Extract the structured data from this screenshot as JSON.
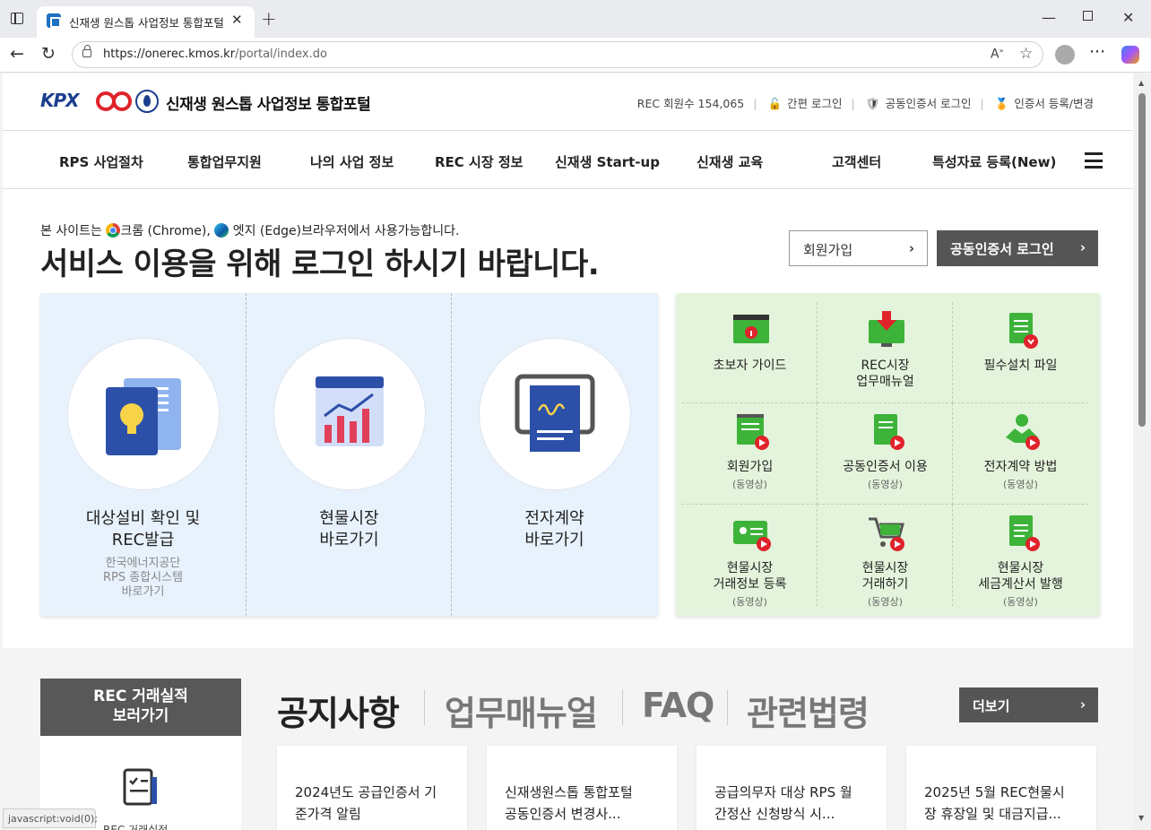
{
  "browser": {
    "tab_title": "신재생 원스톱 사업정보 통합포털",
    "url_host": "https://onerec.kmos.kr",
    "url_path": "/portal/index.do",
    "status_text": "javascript:void(0);"
  },
  "header": {
    "logo_kpx": "KPX",
    "site_title": "신재생 원스톱 사업정보 통합포털",
    "rec_members": "REC 회원수 154,065",
    "simple_login": "간편 로그인",
    "cert_login": "공동인증서 로그인",
    "cert_register": "인증서 등록/변경"
  },
  "gnb": [
    "RPS 사업절차",
    "통합업무지원",
    "나의 사업 정보",
    "REC 시장 정보",
    "신재생 Start-up",
    "신재생 교육",
    "고객센터",
    "특성자료 등록(New)"
  ],
  "intro": {
    "notice_prefix": "본 사이트는",
    "chrome": "크롬 (Chrome),",
    "edge": "엣지 (Edge)브라우저에서 사용가능합니다.",
    "title": "서비스 이용을 위해 로그인 하시기 바랍니다.",
    "join_button": "회원가입",
    "cert_login_button": "공동인증서 로그인"
  },
  "quick": [
    {
      "line1": "대상설비 확인 및",
      "line2": "REC발급",
      "sub1": "한국에너지공단",
      "sub2": "RPS 종합시스템",
      "sub3": "바로가기"
    },
    {
      "line1": "현물시장",
      "line2": "바로가기"
    },
    {
      "line1": "전자계약",
      "line2": "바로가기"
    }
  ],
  "guides": [
    {
      "line1": "초보자 가이드",
      "line2": "",
      "sub": ""
    },
    {
      "line1": "REC시장",
      "line2": "업무매뉴얼",
      "sub": ""
    },
    {
      "line1": "필수설치 파일",
      "line2": "",
      "sub": ""
    },
    {
      "line1": "회원가입",
      "line2": "",
      "sub": "(동영상)"
    },
    {
      "line1": "공동인증서 이용",
      "line2": "",
      "sub": "(동영상)"
    },
    {
      "line1": "전자계약 방법",
      "line2": "",
      "sub": "(동영상)"
    },
    {
      "line1": "현물시장",
      "line2": "거래정보 등록",
      "sub": "(동영상)"
    },
    {
      "line1": "현물시장",
      "line2": "거래하기",
      "sub": "(동영상)"
    },
    {
      "line1": "현물시장",
      "line2": "세금계산서 발행",
      "sub": "(동영상)"
    }
  ],
  "rec_history": {
    "line1": "REC 거래실적",
    "line2": "보러가기",
    "partial": "REC 거래실적"
  },
  "board": {
    "tabs": [
      "공지사항",
      "업무매뉴얼",
      "FAQ",
      "관련법령"
    ],
    "more": "더보기",
    "cards": [
      {
        "l1": "2024년도 공급인증서 기",
        "l2": "준가격 알림"
      },
      {
        "l1": "신재생원스톱 통합포털",
        "l2": "공동인증서 변경사..."
      },
      {
        "l1": "공급의무자 대상 RPS 월",
        "l2": "간정산 신청방식 시..."
      },
      {
        "l1": "2025년 5월 REC현물시",
        "l2": "장 휴장일 및 대금지급..."
      }
    ]
  },
  "colors": {
    "brand_blue": "#1b3f8e",
    "brand_red": "#e0222a",
    "dark_button": "#555555",
    "quick_bg": "#e8f2fc",
    "guide_bg": "#e4f4dc",
    "icon_green": "#3db33a",
    "icon_red": "#e0222a"
  }
}
